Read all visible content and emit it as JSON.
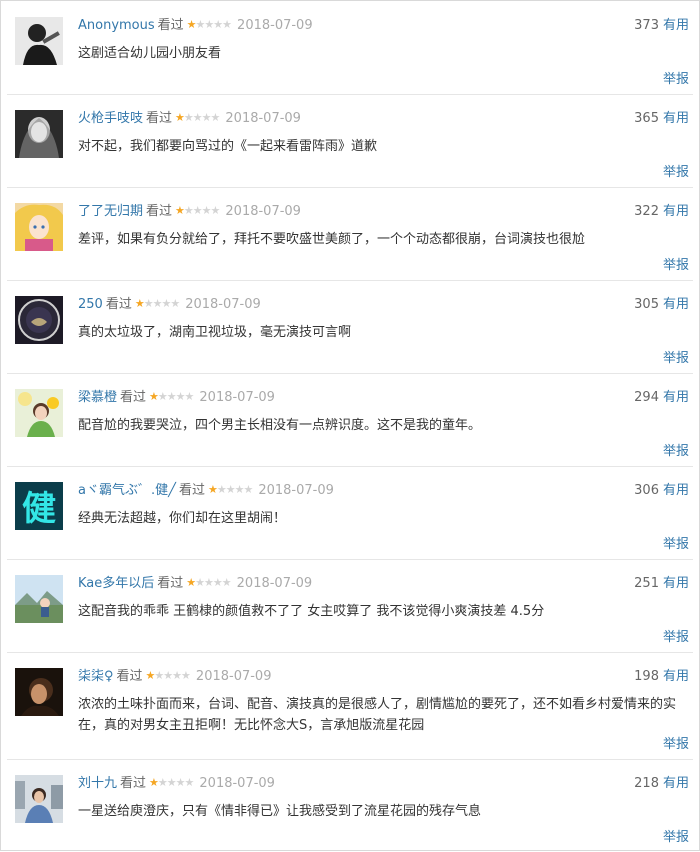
{
  "comments": [
    {
      "user": "Anonymous",
      "status": "看过",
      "rating": 1,
      "date": "2018-07-09",
      "votes": "373",
      "useful": "有用",
      "text": "这剧适合幼儿园小朋友看",
      "report": "举报",
      "avatar": "avatar-man-guitar"
    },
    {
      "user": "火枪手吱吱",
      "status": "看过",
      "rating": 1,
      "date": "2018-07-09",
      "votes": "365",
      "useful": "有用",
      "text": "对不起，我们都要向骂过的《一起来看雷阵雨》道歉",
      "report": "举报",
      "avatar": "avatar-grey-portrait"
    },
    {
      "user": "了了无归期",
      "status": "看过",
      "rating": 1,
      "date": "2018-07-09",
      "votes": "322",
      "useful": "有用",
      "text": "差评，如果有负分就给了，拜托不要吹盛世美颜了，一个个动态都很崩，台词演技也很尬",
      "report": "举报",
      "avatar": "avatar-anime"
    },
    {
      "user": "250",
      "status": "看过",
      "rating": 1,
      "date": "2018-07-09",
      "votes": "305",
      "useful": "有用",
      "text": "真的太垃圾了，湖南卫视垃圾，毫无演技可言啊",
      "report": "举报",
      "avatar": "avatar-badge"
    },
    {
      "user": "梁慕橙",
      "status": "看过",
      "rating": 1,
      "date": "2018-07-09",
      "votes": "294",
      "useful": "有用",
      "text": "配音尬的我要哭泣，四个男主长相没有一点辨识度。这不是我的童年。",
      "report": "举报",
      "avatar": "avatar-girl-flowers"
    },
    {
      "user": "aヾ霸气ぶ゛.健╱",
      "status": "看过",
      "rating": 1,
      "date": "2018-07-09",
      "votes": "306",
      "useful": "有用",
      "text": "经典无法超越，你们却在这里胡闹！",
      "report": "举报",
      "avatar": "avatar-character-jian",
      "glyph": "健"
    },
    {
      "user": "Kae多年以后",
      "status": "看过",
      "rating": 1,
      "date": "2018-07-09",
      "votes": "251",
      "useful": "有用",
      "text": "这配音我的乖乖 王鹤棣的颜值救不了了 女主哎算了 我不该觉得小爽演技差 4.5分",
      "report": "举报",
      "avatar": "avatar-landscape"
    },
    {
      "user": "柒柒♀",
      "status": "看过",
      "rating": 1,
      "date": "2018-07-09",
      "votes": "198",
      "useful": "有用",
      "text": "浓浓的土味扑面而来，台词、配音、演技真的是很感人了，剧情尴尬的要死了，还不如看乡村爱情来的实在，真的对男女主丑拒啊！无比怀念大S，言承旭版流星花园",
      "report": "举报",
      "avatar": "avatar-dark-portrait"
    },
    {
      "user": "刘十九",
      "status": "看过",
      "rating": 1,
      "date": "2018-07-09",
      "votes": "218",
      "useful": "有用",
      "text": "一星送给庾澄庆，只有《情非得已》让我感受到了流星花园的残存气息",
      "report": "举报",
      "avatar": "avatar-city-photo"
    }
  ]
}
